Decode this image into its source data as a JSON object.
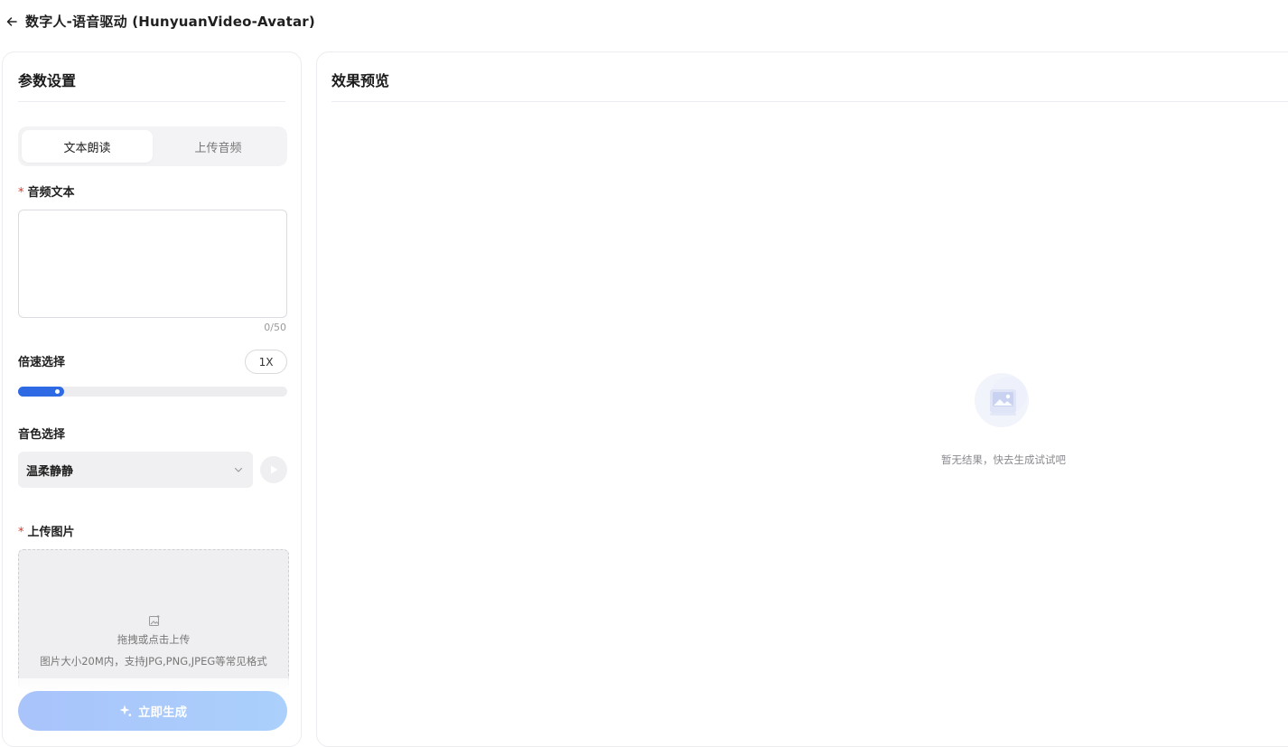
{
  "header": {
    "back_icon": "arrow-left-icon",
    "title": "数字人-语音驱动 (HunyuanVideo-Avatar)"
  },
  "settings": {
    "title": "参数设置",
    "tabs": [
      {
        "label": "文本朗读",
        "active": true
      },
      {
        "label": "上传音频",
        "active": false
      }
    ],
    "audio_text": {
      "required_mark": "*",
      "label": "音频文本",
      "value": "",
      "counter": "0/50"
    },
    "speed": {
      "label": "倍速选择",
      "value_label": "1X",
      "level_fraction": 0.17
    },
    "voice": {
      "label": "音色选择",
      "selected": "温柔静静",
      "chevron_icon": "chevron-down-icon",
      "play_icon": "play-icon"
    },
    "image_upload": {
      "required_mark": "*",
      "label": "上传图片",
      "icon": "image-upload-icon",
      "tip": "拖拽或点击上传",
      "hint": "图片大小20M内，支持JPG,PNG,JPEG等常见格式"
    },
    "generate": {
      "icon": "sparkle-icon",
      "label": "立即生成"
    }
  },
  "preview": {
    "title": "效果预览",
    "empty_icon": "empty-image-icon",
    "empty_text": "暂无结果，快去生成试试吧"
  },
  "colors": {
    "accent": "#2f6ae5",
    "required": "#e0352b",
    "button_gradient_start": "#a9c3fb",
    "button_gradient_end": "#aad0fb"
  }
}
